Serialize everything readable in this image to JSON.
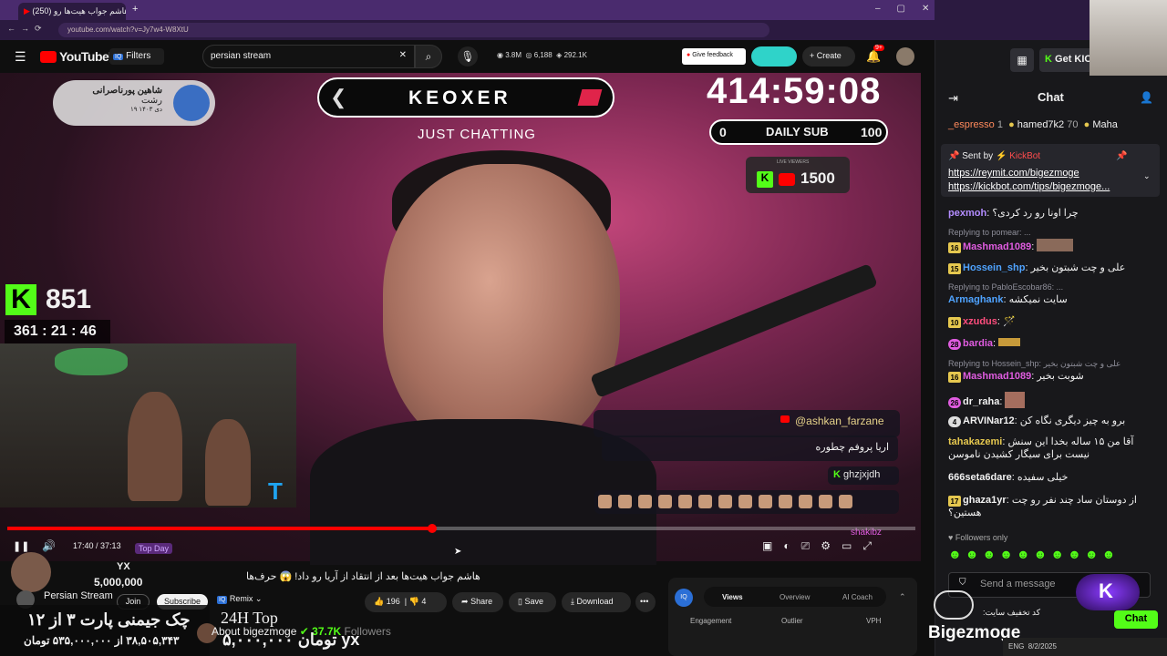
{
  "browser": {
    "tab_title": "(250) هاشم جواب هیت‌ها رو...",
    "url": "youtube.com/watch?v=Jy7w4-W8XtU"
  },
  "youtube": {
    "logo": "YouTube",
    "region": "PL",
    "filters_label": "Filters",
    "search_value": "persian stream",
    "stats": [
      "3.8M",
      "6,188",
      "292.1K"
    ],
    "feedback_label": "Give feedback",
    "create_label": "Create",
    "notif_count": "9+"
  },
  "video": {
    "brand_name": "KEOXER",
    "brand_sub": "JUST CHATTING",
    "stream_timer": "414:59:08",
    "sub_left": "0",
    "sub_label": "DAILY SUB",
    "sub_right": "100",
    "live_viewers_label": "LIVE VIEWERS",
    "live_viewers": "1500",
    "namecard_name": "شاهین پورناصرانی",
    "namecard_city": "رشت",
    "namecard_date": "۱۹ دی ۱۴۰۳",
    "kick_count": "851",
    "countdown": "361 : 21 : 46",
    "overlay_user": "@ashkan_farzane",
    "overlay_msg": "اریا پروفم چطوره",
    "overlay_k_user": "ghzjxjdh",
    "overlay_bottom_user": "shakibz",
    "time_current": "17:40",
    "time_total": "37:13",
    "progress_fraction": 0.468
  },
  "below": {
    "title": "هاشم جواب هیت‌ها بعد از انتقاد از آریا رو داد! 😱 حرف‌ها",
    "channel": "Persian Stream",
    "join_label": "Join",
    "subscribe_label": "Subscribe",
    "remix_label": "Remix",
    "likes": "196",
    "dislikes": "4",
    "share_label": "Share",
    "save_label": "Save",
    "download_label": "Download",
    "iq_tabs": [
      "Views",
      "Overview",
      "AI Coach"
    ],
    "iq_row2": [
      "Engagement",
      "Outlier",
      "VPH"
    ],
    "gift_user": "YX",
    "gift_amount": "5,000,000",
    "top_day": "Top Day",
    "top_24h": "24H Top",
    "ad_line1": "چک جیمنی پارت ۳ از ۱۲",
    "ad_line2": "۳۸,۵۰۵,۳۴۳ از ۵۳۵,۰۰۰,۰۰۰ تومان",
    "ad_right2": "۵,۰۰۰,۰۰۰ تومان yx",
    "about_label": "About bigezmoge",
    "followers_count": "37.7K",
    "followers_label": "Followers"
  },
  "chat": {
    "get_kick_label": "Get KICK",
    "title": "Chat",
    "top_users": [
      {
        "name": "_espresso",
        "count": "1"
      },
      {
        "name": "hamed7k2",
        "count": "70"
      },
      {
        "name": "Maha",
        "count": ""
      }
    ],
    "pinned_sent_by": "Sent by",
    "pinned_bot": "KickBot",
    "pinned_links": [
      "https://reymit.com/bigezmoge",
      "https://kickbot.com/tips/bigezmoge..."
    ],
    "messages": [
      {
        "user": "pexmoh",
        "color": "#b38cff",
        "text": "چرا اونا رو رد کردی؟"
      },
      {
        "reply": "Replying to pomear: ...",
        "user": "Mashmad1089",
        "color": "#e05ce0",
        "text": ""
      },
      {
        "user": "Hossein_shp",
        "color": "#4fa3ff",
        "text": "علی و چت شبتون بخیر"
      },
      {
        "reply": "Replying to PabloEscobar86: ...",
        "user": "Armaghank",
        "color": "#4fa3ff",
        "text": "سایت نمیکشه"
      },
      {
        "user": "xzudus",
        "color": "#ff4d7d",
        "text": ""
      },
      {
        "user": "bardia",
        "color": "#e05ce0",
        "text": ""
      },
      {
        "reply": "Replying to Hossein_shp: علی و چت شبتون بخیر",
        "user": "Mashmad1089",
        "color": "#e05ce0",
        "text": "شوبت بخیر"
      },
      {
        "user": "dr_raha",
        "color": "#ffffff",
        "text": ""
      },
      {
        "user": "ARVINar12",
        "color": "#ffffff",
        "text": "برو به چیز دیگری نگاه کن"
      },
      {
        "user": "tahakazemi",
        "color": "#e6c84f",
        "text": "آقا من ۱۵ ساله بخدا این سنش نیست برای سیگار کشیدن ناموسن"
      },
      {
        "user": "666seta6dare",
        "color": "#ffffff",
        "text": "خیلی سفیده"
      },
      {
        "user": "ghaza1yr",
        "color": "#ffffff",
        "text": "از دوستان ساد چند نفر رو چت هستین؟"
      }
    ],
    "followers_only": "Followers only",
    "send_placeholder": "Send a message",
    "chat_button": "Chat",
    "streamer": "Bigezmoge",
    "site_note": "کد تخفیف سایت:"
  },
  "taskbar": {
    "lang": "ENG",
    "date": "8/2/2025"
  },
  "colors": {
    "kick_green": "#53fc18",
    "yt_red": "#ff0000",
    "accent_purple": "#4a2b6e"
  }
}
